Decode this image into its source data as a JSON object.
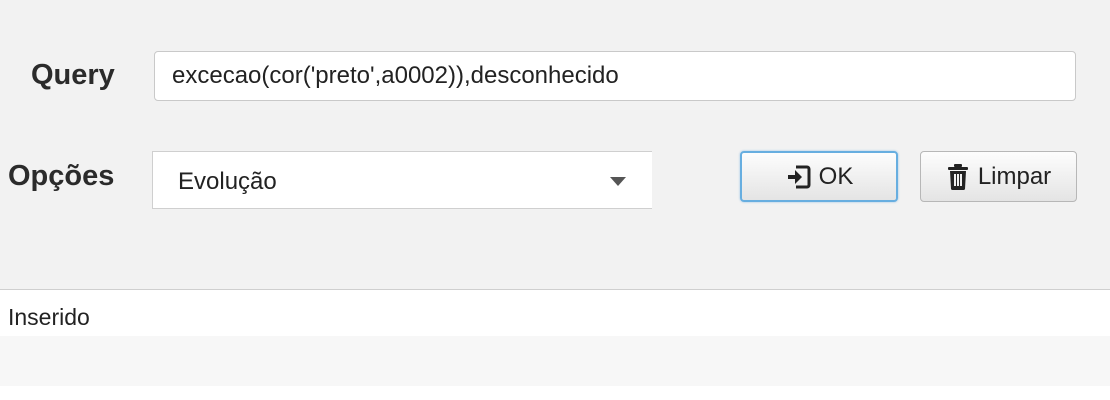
{
  "form": {
    "query_label": "Query",
    "query_value": "excecao(cor('preto',a0002)),desconhecido",
    "options_label": "Opções",
    "options_selected": "Evolução"
  },
  "buttons": {
    "ok_label": "OK",
    "ok_icon": "sign-in-icon",
    "clear_label": "Limpar",
    "clear_icon": "trash-icon"
  },
  "status": {
    "text": "Inserido"
  },
  "colors": {
    "focus_border": "#67aee0",
    "background": "#f2f2f2"
  }
}
